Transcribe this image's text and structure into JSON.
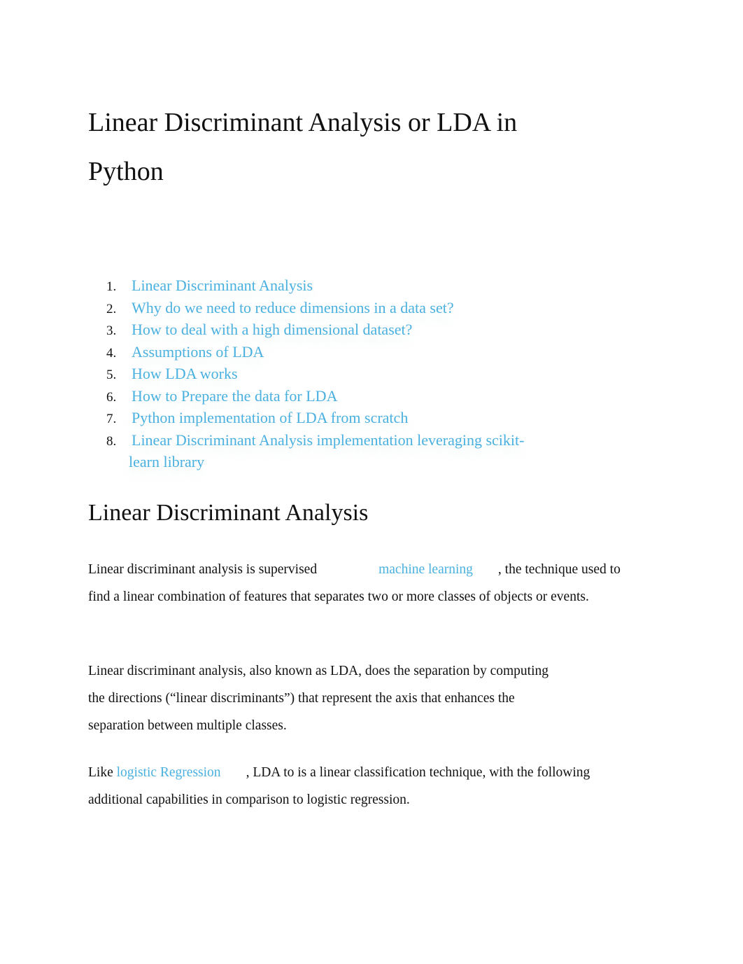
{
  "title": "Linear Discriminant Analysis or LDA in Python",
  "toc": [
    {
      "num": "1.",
      "label": "Linear Discriminant Analysis"
    },
    {
      "num": "2.",
      "label": "Why do we need to reduce dimensions in a data set?"
    },
    {
      "num": "3.",
      "label": "How to deal with a high dimensional dataset?"
    },
    {
      "num": "4.",
      "label": "Assumptions of LDA"
    },
    {
      "num": "5.",
      "label": "How LDA works"
    },
    {
      "num": "6.",
      "label": "How to Prepare the data for LDA"
    },
    {
      "num": "7.",
      "label": "Python implementation of LDA from scratch"
    },
    {
      "num": "8.",
      "label": "Linear Discriminant Analysis implementation leveraging scikit-learn library"
    }
  ],
  "section_heading": "Linear Discriminant Analysis",
  "paragraphs": {
    "p1": {
      "before": "Linear discriminant analysis is supervised",
      "link": "machine learning",
      "after": ", the technique used to find a linear combination of features that separates two or more classes of objects or events."
    },
    "p2": {
      "text": "Linear discriminant analysis, also known as LDA, does the separation by computing the directions (“linear discriminants”) that represent the axis that enhances the separation between multiple classes."
    },
    "p3": {
      "before": "Like",
      "link": "logistic Regression",
      "after": ", LDA to is a linear classification technique, with the following additional capabilities in comparison to logistic regression."
    }
  }
}
